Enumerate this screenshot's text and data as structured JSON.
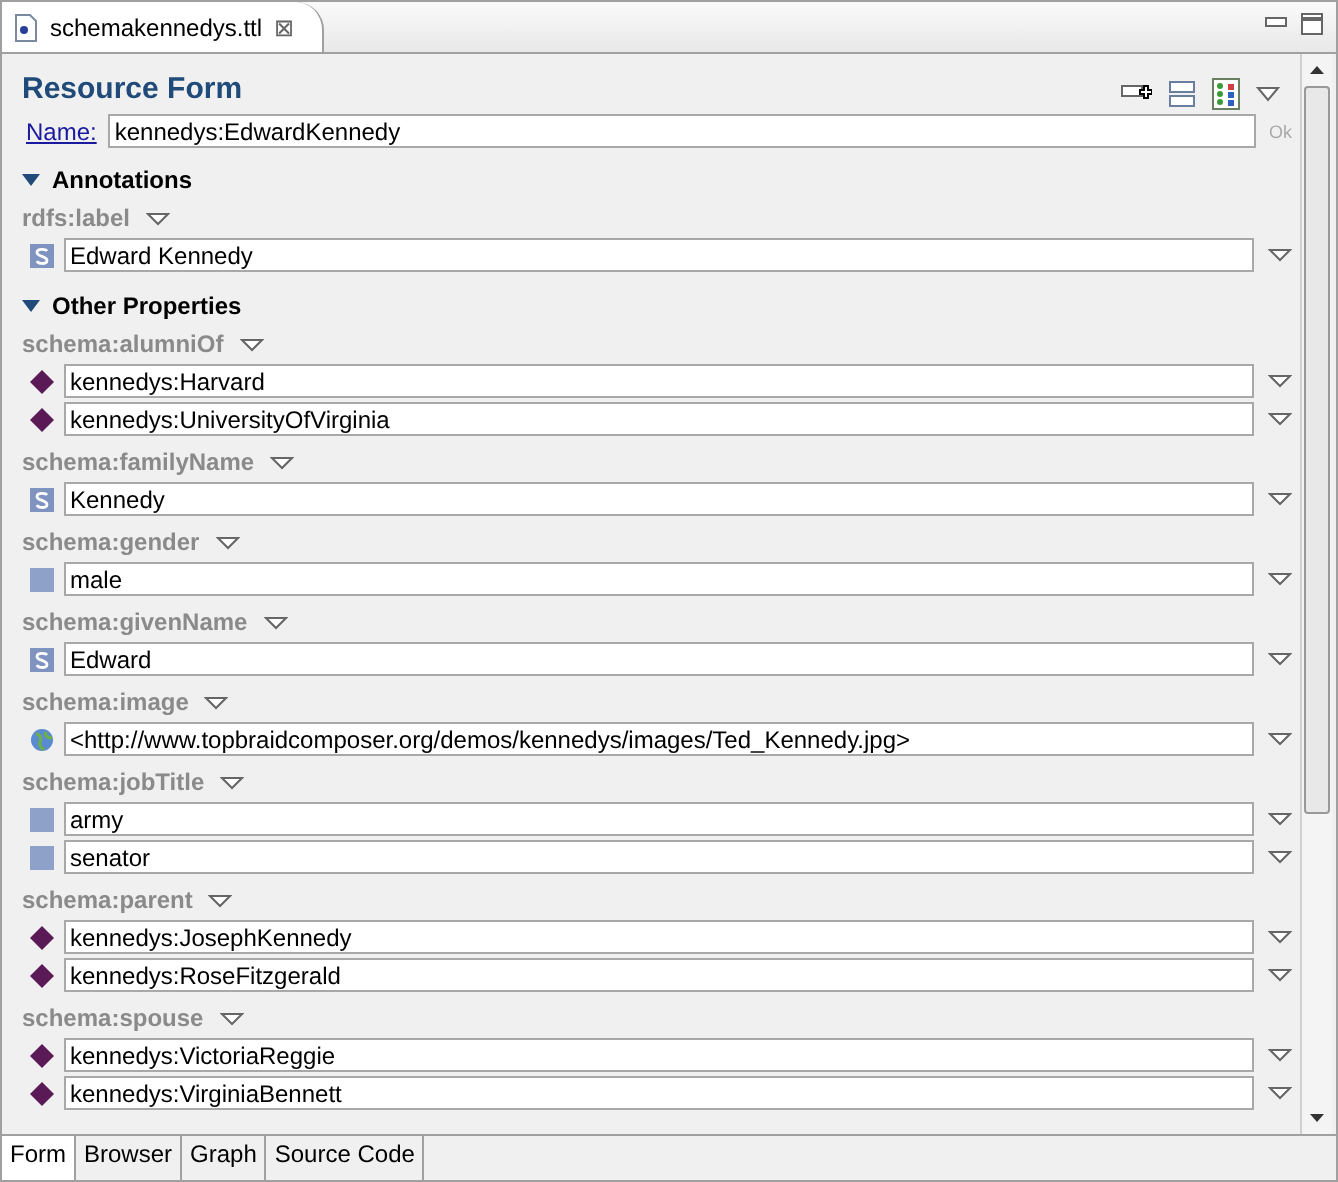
{
  "editor_tab": {
    "title": "schemakennedys.ttl",
    "close": "⊠"
  },
  "form": {
    "title": "Resource Form",
    "name_label": "Name:",
    "name_value": "kennedys:EdwardKennedy",
    "ok": "Ok"
  },
  "sections": [
    {
      "title": "Annotations",
      "expanded": true,
      "properties": [
        {
          "name": "rdfs:label",
          "values": [
            {
              "kind": "string",
              "text": "Edward Kennedy"
            }
          ]
        }
      ]
    },
    {
      "title": "Other Properties",
      "expanded": true,
      "properties": [
        {
          "name": "schema:alumniOf",
          "values": [
            {
              "kind": "resource",
              "text": "kennedys:Harvard"
            },
            {
              "kind": "resource",
              "text": "kennedys:UniversityOfVirginia"
            }
          ]
        },
        {
          "name": "schema:familyName",
          "values": [
            {
              "kind": "string",
              "text": "Kennedy"
            }
          ]
        },
        {
          "name": "schema:gender",
          "values": [
            {
              "kind": "plain",
              "text": "male"
            }
          ]
        },
        {
          "name": "schema:givenName",
          "values": [
            {
              "kind": "string",
              "text": "Edward"
            }
          ]
        },
        {
          "name": "schema:image",
          "values": [
            {
              "kind": "uri",
              "text": "<http://www.topbraidcomposer.org/demos/kennedys/images/Ted_Kennedy.jpg>"
            }
          ]
        },
        {
          "name": "schema:jobTitle",
          "values": [
            {
              "kind": "plain",
              "text": "army"
            },
            {
              "kind": "plain",
              "text": "senator"
            }
          ]
        },
        {
          "name": "schema:parent",
          "values": [
            {
              "kind": "resource",
              "text": "kennedys:JosephKennedy"
            },
            {
              "kind": "resource",
              "text": "kennedys:RoseFitzgerald"
            }
          ]
        },
        {
          "name": "schema:spouse",
          "values": [
            {
              "kind": "resource",
              "text": "kennedys:VictoriaReggie"
            },
            {
              "kind": "resource",
              "text": "kennedys:VirginiaBennett"
            }
          ]
        }
      ]
    }
  ],
  "bottom_tabs": [
    {
      "label": "Form",
      "selected": true
    },
    {
      "label": "Browser",
      "selected": false
    },
    {
      "label": "Graph",
      "selected": false
    },
    {
      "label": "Source Code",
      "selected": false
    }
  ]
}
